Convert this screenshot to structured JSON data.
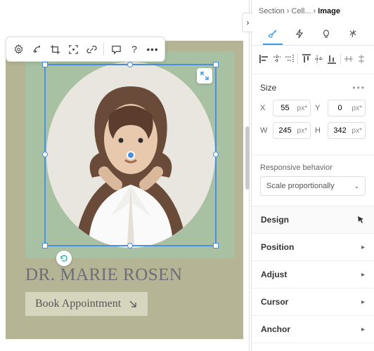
{
  "toolbar": {
    "buttons": [
      "settings",
      "animate",
      "crop",
      "focal",
      "link",
      "sep",
      "comment",
      "help",
      "more"
    ]
  },
  "canvas": {
    "title_text": "DR. MARIE ROSEN",
    "cta_label": "Book Appointment",
    "colors": {
      "page_bg": "#b5b495",
      "card_bg": "#a7c1a2",
      "selection": "#4a90e2"
    }
  },
  "inspector": {
    "breadcrumb": {
      "a": "Section",
      "b": "Cell...",
      "c": "Image"
    },
    "size": {
      "header": "Size",
      "x": {
        "label": "X",
        "value": "55",
        "unit": "px*"
      },
      "y": {
        "label": "Y",
        "value": "0",
        "unit": "px*"
      },
      "w": {
        "label": "W",
        "value": "245",
        "unit": "px*"
      },
      "h": {
        "label": "H",
        "value": "342",
        "unit": "px*"
      }
    },
    "responsive": {
      "label": "Responsive behavior",
      "value": "Scale proportionally"
    },
    "accordion": [
      "Design",
      "Position",
      "Adjust",
      "Cursor",
      "Anchor"
    ]
  }
}
